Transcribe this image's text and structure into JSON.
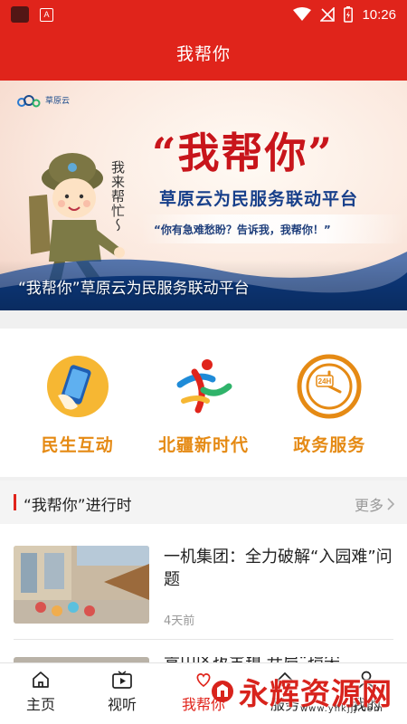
{
  "status_bar": {
    "time": "10:26",
    "app_badge": "A",
    "icons": [
      "app-square-icon",
      "a-badge-icon",
      "wifi-icon",
      "no-signal-icon",
      "battery-charging-icon"
    ]
  },
  "header": {
    "title": "我帮你"
  },
  "banner": {
    "logo_text": "草原云",
    "big_title": "“我帮你”",
    "subtitle": "草原云为民服务联动平台",
    "slogan": "“你有急难愁盼？告诉我，我帮你！”",
    "handwriting": "我来帮忙～",
    "caption": "“我帮你”草原云为民服务联动平台"
  },
  "quick_entries": [
    {
      "label": "民生互动",
      "icon": "phone-hand-icon"
    },
    {
      "label": "北疆新时代",
      "icon": "dancing-figure-icon"
    },
    {
      "label": "政务服务",
      "icon": "clock-24h-icon"
    }
  ],
  "section": {
    "title": "“我帮你”进行时",
    "more_label": "更多"
  },
  "news": [
    {
      "headline": "一机集团：全力破解“入园难”问题",
      "time": "4天前"
    },
    {
      "headline": "青山区拔宝镇 开启“指尖"
    }
  ],
  "tabs": [
    {
      "label": "主页",
      "icon": "home-icon",
      "active": false
    },
    {
      "label": "视听",
      "icon": "video-icon",
      "active": false
    },
    {
      "label": "我帮你",
      "icon": "heart-hands-icon",
      "active": true
    },
    {
      "label": "服务",
      "icon": "service-icon",
      "active": false
    },
    {
      "label": "我的",
      "icon": "user-icon",
      "active": false
    }
  ],
  "watermark": {
    "text": "永辉资源网",
    "url": "www.yhkjjj.com"
  },
  "colors": {
    "brand_red": "#e0241b",
    "entry_orange": "#e58a14",
    "muted_gray": "#999999"
  }
}
